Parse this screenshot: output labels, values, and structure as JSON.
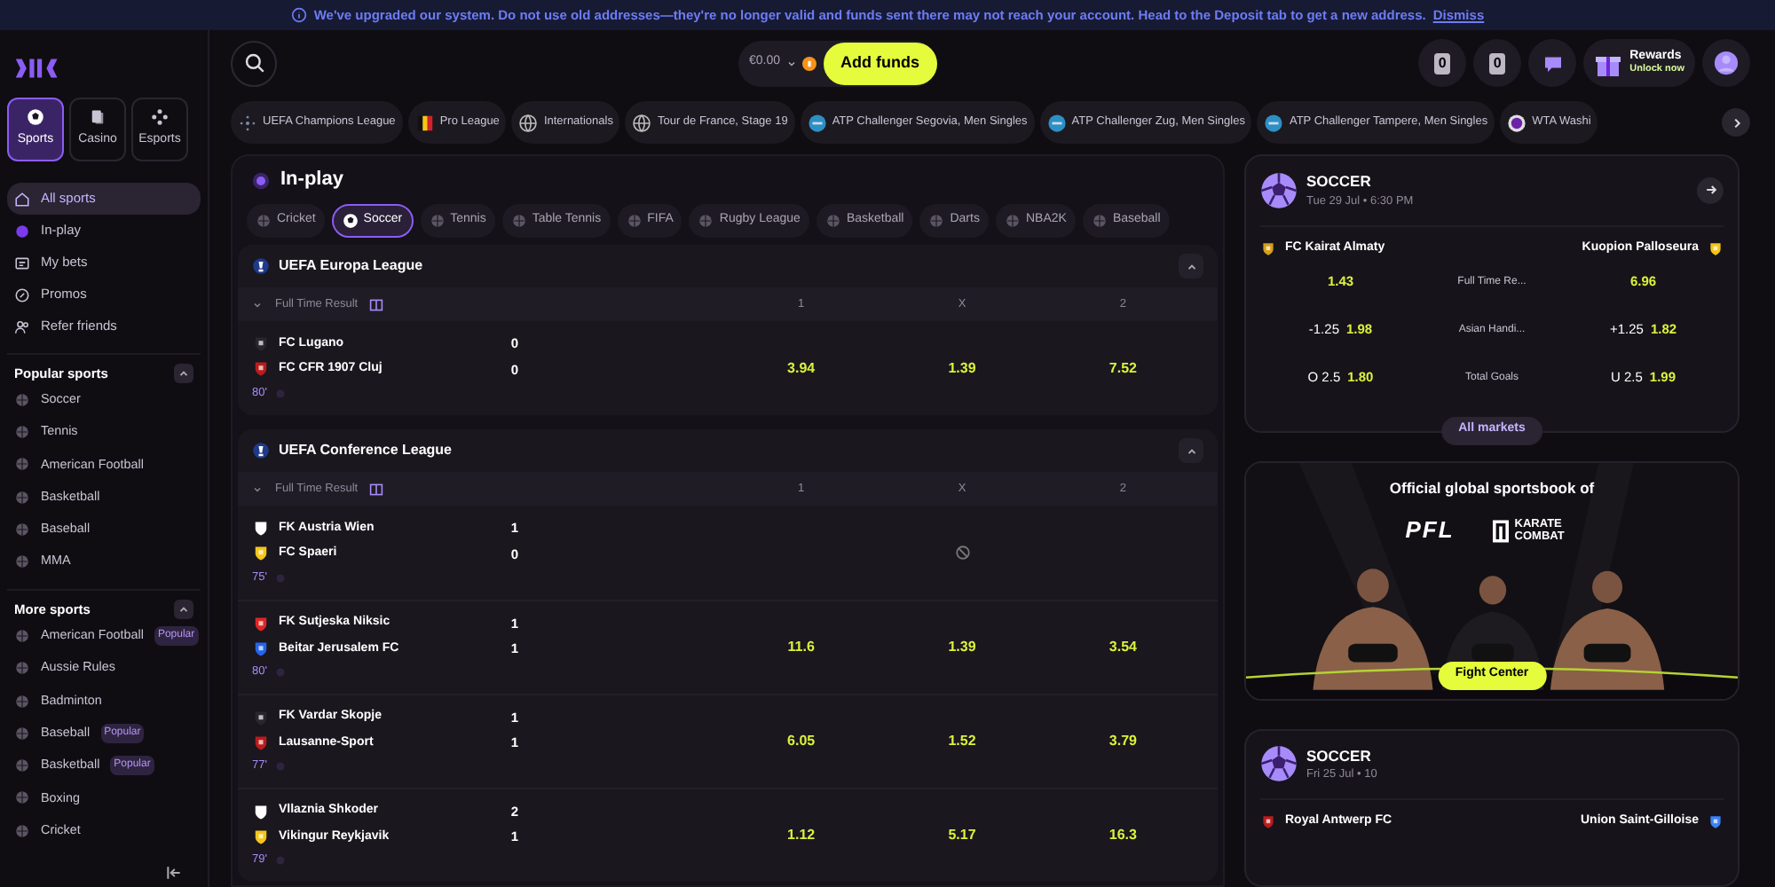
{
  "notice": {
    "text": "We've upgraded our system. Do not use old addresses—they're no longer valid and funds sent there may not reach your account. Head to the Deposit tab to get a new address.",
    "link": "Dismiss"
  },
  "sidebar": {
    "tiles": [
      {
        "label": "Sports",
        "selected": true
      },
      {
        "label": "Casino",
        "selected": false
      },
      {
        "label": "Esports",
        "selected": false
      }
    ],
    "nav": [
      {
        "label": "All sports",
        "selected": true,
        "kind": "home"
      },
      {
        "label": "In-play",
        "selected": false,
        "kind": "live"
      },
      {
        "label": "My bets",
        "selected": false,
        "kind": "bets"
      },
      {
        "label": "Promos",
        "selected": false,
        "kind": "promo"
      },
      {
        "label": "Refer friends",
        "selected": false,
        "kind": "friends"
      }
    ],
    "sections": [
      {
        "title": "Popular sports",
        "expanded": true,
        "items": [
          {
            "label": "Soccer"
          },
          {
            "label": "Tennis"
          },
          {
            "label": "American Football"
          },
          {
            "label": "Basketball"
          },
          {
            "label": "Baseball"
          },
          {
            "label": "MMA"
          }
        ]
      },
      {
        "title": "More sports",
        "expanded": true,
        "items": [
          {
            "label": "American Football",
            "badge": "Popular"
          },
          {
            "label": "Aussie Rules"
          },
          {
            "label": "Badminton"
          },
          {
            "label": "Baseball",
            "badge": "Popular"
          },
          {
            "label": "Basketball",
            "badge": "Popular"
          },
          {
            "label": "Boxing"
          },
          {
            "label": "Cricket"
          }
        ]
      }
    ]
  },
  "header": {
    "balance": "€0.00",
    "add_funds": "Add funds",
    "counters": [
      "0",
      "0"
    ],
    "rewards": {
      "title": "Rewards",
      "subtitle": "Unlock now"
    }
  },
  "competitions": [
    "UEFA Champions League",
    "Pro League",
    "Internationals",
    "Tour de France, Stage 19",
    "ATP Challenger Segovia, Men Singles",
    "ATP Challenger Zug, Men Singles",
    "ATP Challenger Tampere, Men Singles",
    "WTA Washi"
  ],
  "inplay": {
    "title": "In-play",
    "sports": [
      {
        "label": "Cricket",
        "selected": false
      },
      {
        "label": "Soccer",
        "selected": true
      },
      {
        "label": "Tennis",
        "selected": false
      },
      {
        "label": "Table Tennis",
        "selected": false
      },
      {
        "label": "FIFA",
        "selected": false
      },
      {
        "label": "Rugby League",
        "selected": false
      },
      {
        "label": "Basketball",
        "selected": false
      },
      {
        "label": "Darts",
        "selected": false
      },
      {
        "label": "NBA2K",
        "selected": false
      },
      {
        "label": "Baseball",
        "selected": false
      }
    ],
    "leagues": [
      {
        "name": "UEFA Europa League",
        "market": "Full Time Result",
        "columns": [
          "1",
          "X",
          "2"
        ],
        "matches": [
          {
            "home": "FC Lugano",
            "away": "FC CFR 1907 Cluj",
            "home_score": "0",
            "away_score": "0",
            "minute": "80'",
            "suspended": false,
            "odds": [
              "3.94",
              "1.39",
              "7.52"
            ]
          }
        ]
      },
      {
        "name": "UEFA Conference League",
        "market": "Full Time Result",
        "columns": [
          "1",
          "X",
          "2"
        ],
        "matches": [
          {
            "home": "FK Austria Wien",
            "away": "FC Spaeri",
            "home_score": "1",
            "away_score": "0",
            "minute": "75'",
            "suspended": true
          },
          {
            "home": "FK Sutjeska Niksic",
            "away": "Beitar Jerusalem FC",
            "home_score": "1",
            "away_score": "1",
            "minute": "80'",
            "suspended": false,
            "odds": [
              "11.6",
              "1.39",
              "3.54"
            ]
          },
          {
            "home": "FK Vardar Skopje",
            "away": "Lausanne-Sport",
            "home_score": "1",
            "away_score": "1",
            "minute": "77'",
            "suspended": false,
            "odds": [
              "6.05",
              "1.52",
              "3.79"
            ]
          },
          {
            "home": "Vllaznia Shkoder",
            "away": "Vikingur Reykjavik",
            "home_score": "2",
            "away_score": "1",
            "minute": "79'",
            "suspended": false,
            "odds": [
              "1.12",
              "5.17",
              "16.3"
            ]
          }
        ]
      }
    ]
  },
  "featured": [
    {
      "sport": "SOCCER",
      "date": "Tue 29 Jul • 6:30 PM",
      "home": "FC Kairat Almaty",
      "away": "Kuopion Palloseura",
      "markets": [
        {
          "label": "Full Time Re...",
          "home_odds": "1.43",
          "away_odds": "6.96"
        },
        {
          "label": "Asian Handi...",
          "home_line": "-1.25",
          "home_odds": "1.98",
          "away_line": "+1.25",
          "away_odds": "1.82"
        },
        {
          "label": "Total Goals",
          "home_line": "O 2.5",
          "home_odds": "1.80",
          "away_line": "U 2.5",
          "away_odds": "1.99"
        }
      ],
      "more": "All markets"
    },
    {
      "sport": "SOCCER",
      "date": "Fri 25 Jul • 10",
      "home": "Royal Antwerp FC",
      "away": "Union Saint-Gilloise"
    }
  ],
  "promo": {
    "headline": "Official global sportsbook of",
    "partners": [
      "PFL",
      "KARATE COMBAT"
    ],
    "button": "Fight Center"
  }
}
